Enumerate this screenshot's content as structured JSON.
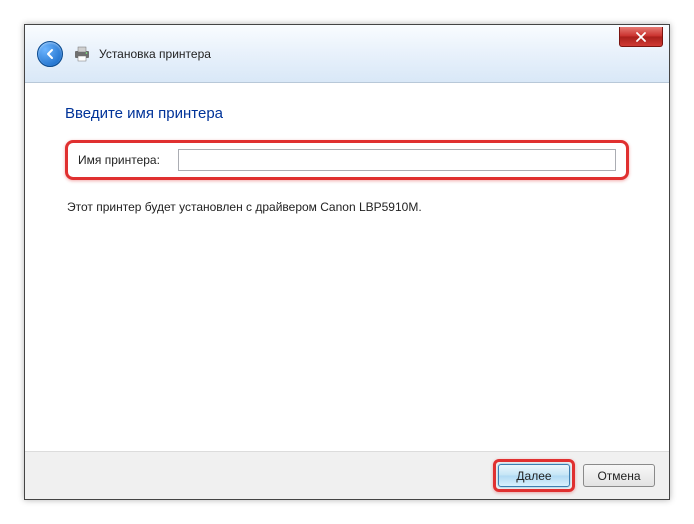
{
  "window": {
    "title": "Установка принтера"
  },
  "content": {
    "heading": "Введите имя принтера",
    "field_label": "Имя принтера:",
    "printer_name_value": "",
    "info_text": "Этот принтер будет установлен с драйвером Canon LBP5910M."
  },
  "footer": {
    "next_label": "Далее",
    "cancel_label": "Отмена"
  }
}
